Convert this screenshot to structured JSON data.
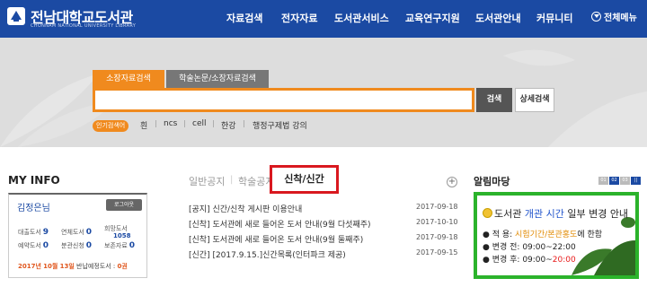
{
  "header": {
    "logo_title": "전남대학교도서관",
    "logo_subtitle": "CHONNAM NATIONAL UNIVERSITY LIBRARY",
    "nav": [
      "자료검색",
      "전자자료",
      "도서관서비스",
      "교육연구지원",
      "도서관안내",
      "커뮤니티"
    ],
    "menu_all": "전체메뉴"
  },
  "search": {
    "tabs": [
      "소장자료검색",
      "학술논문/소장자료검색"
    ],
    "query": "",
    "search_button": "검색",
    "detail_button": "상세검색",
    "popular_label": "인기검색어",
    "popular_keywords": [
      "흰",
      "ncs",
      "cell",
      "한강",
      "행정구제법 강의"
    ]
  },
  "myinfo": {
    "title": "MY INFO",
    "user": "김정은님",
    "logout": "로그아웃",
    "stats": [
      {
        "label": "대출도서",
        "value": "9"
      },
      {
        "label": "연체도서",
        "value": "0"
      },
      {
        "label": "희망도서",
        "value": "1058"
      },
      {
        "label": "예약도서",
        "value": "0"
      },
      {
        "label": "분관신청",
        "value": "0"
      },
      {
        "label": "보존자료",
        "value": "0"
      }
    ],
    "return_prefix": "2017년",
    "return_month": "10월",
    "return_day": "13일",
    "return_text": "반납예정도서 :",
    "return_count": "0권"
  },
  "notices": {
    "tabs": [
      "일반공지",
      "학술공지",
      "신착/신간"
    ],
    "plus": "+",
    "items": [
      {
        "title": "[공지] 신간/신착 게시판 이용안내",
        "date": "2017-09-18"
      },
      {
        "title": "[신착] 도서관에 새로 들어온 도서 안내(9월 다섯째주)",
        "date": "2017-10-10"
      },
      {
        "title": "[신착] 도서관에 새로 들어온 도서 안내(9월 둘째주)",
        "date": "2017-09-18"
      },
      {
        "title": "[신간] [2017.9.15.]신간목록(인터파크 제공)",
        "date": "2017-09-15"
      }
    ]
  },
  "alarm": {
    "title": "알림마당",
    "pager": [
      "01",
      "02",
      "03"
    ],
    "headline_pre": "도서관 ",
    "headline_blue": "개관 시간",
    "headline_post": " 일부 변경 안내",
    "line1_label": "적   용: ",
    "line1_value": "시험기간/본관홍도",
    "line1_suffix": "에 한함",
    "line2": "변경 전: 09:00~22:00",
    "line3_label": "변경 후: 09:00~",
    "line3_red": "20:00"
  },
  "colors": {
    "header_bg": "#1b4aa3",
    "accent_orange": "#f08a1e",
    "highlight_red": "#d9181f",
    "alarm_green": "#2bb32b"
  }
}
